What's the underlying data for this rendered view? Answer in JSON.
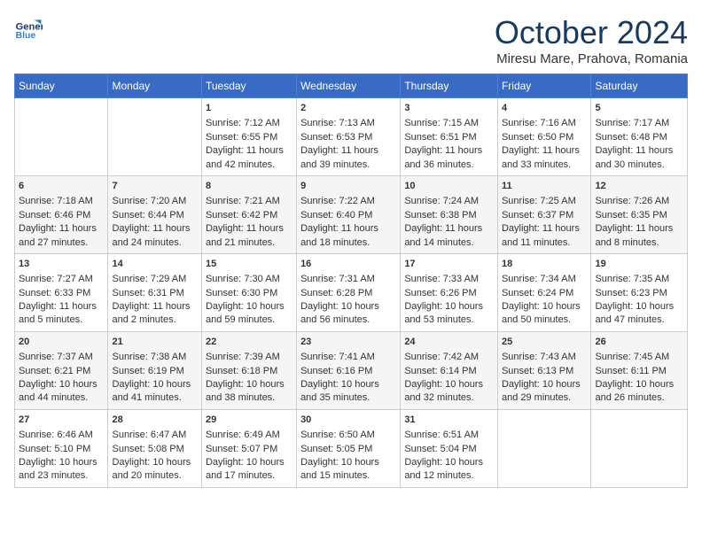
{
  "header": {
    "logo_line1": "General",
    "logo_line2": "Blue",
    "month": "October 2024",
    "location": "Miresu Mare, Prahova, Romania"
  },
  "days_of_week": [
    "Sunday",
    "Monday",
    "Tuesday",
    "Wednesday",
    "Thursday",
    "Friday",
    "Saturday"
  ],
  "weeks": [
    [
      {
        "day": "",
        "info": ""
      },
      {
        "day": "",
        "info": ""
      },
      {
        "day": "1",
        "sunrise": "Sunrise: 7:12 AM",
        "sunset": "Sunset: 6:55 PM",
        "daylight": "Daylight: 11 hours and 42 minutes."
      },
      {
        "day": "2",
        "sunrise": "Sunrise: 7:13 AM",
        "sunset": "Sunset: 6:53 PM",
        "daylight": "Daylight: 11 hours and 39 minutes."
      },
      {
        "day": "3",
        "sunrise": "Sunrise: 7:15 AM",
        "sunset": "Sunset: 6:51 PM",
        "daylight": "Daylight: 11 hours and 36 minutes."
      },
      {
        "day": "4",
        "sunrise": "Sunrise: 7:16 AM",
        "sunset": "Sunset: 6:50 PM",
        "daylight": "Daylight: 11 hours and 33 minutes."
      },
      {
        "day": "5",
        "sunrise": "Sunrise: 7:17 AM",
        "sunset": "Sunset: 6:48 PM",
        "daylight": "Daylight: 11 hours and 30 minutes."
      }
    ],
    [
      {
        "day": "6",
        "sunrise": "Sunrise: 7:18 AM",
        "sunset": "Sunset: 6:46 PM",
        "daylight": "Daylight: 11 hours and 27 minutes."
      },
      {
        "day": "7",
        "sunrise": "Sunrise: 7:20 AM",
        "sunset": "Sunset: 6:44 PM",
        "daylight": "Daylight: 11 hours and 24 minutes."
      },
      {
        "day": "8",
        "sunrise": "Sunrise: 7:21 AM",
        "sunset": "Sunset: 6:42 PM",
        "daylight": "Daylight: 11 hours and 21 minutes."
      },
      {
        "day": "9",
        "sunrise": "Sunrise: 7:22 AM",
        "sunset": "Sunset: 6:40 PM",
        "daylight": "Daylight: 11 hours and 18 minutes."
      },
      {
        "day": "10",
        "sunrise": "Sunrise: 7:24 AM",
        "sunset": "Sunset: 6:38 PM",
        "daylight": "Daylight: 11 hours and 14 minutes."
      },
      {
        "day": "11",
        "sunrise": "Sunrise: 7:25 AM",
        "sunset": "Sunset: 6:37 PM",
        "daylight": "Daylight: 11 hours and 11 minutes."
      },
      {
        "day": "12",
        "sunrise": "Sunrise: 7:26 AM",
        "sunset": "Sunset: 6:35 PM",
        "daylight": "Daylight: 11 hours and 8 minutes."
      }
    ],
    [
      {
        "day": "13",
        "sunrise": "Sunrise: 7:27 AM",
        "sunset": "Sunset: 6:33 PM",
        "daylight": "Daylight: 11 hours and 5 minutes."
      },
      {
        "day": "14",
        "sunrise": "Sunrise: 7:29 AM",
        "sunset": "Sunset: 6:31 PM",
        "daylight": "Daylight: 11 hours and 2 minutes."
      },
      {
        "day": "15",
        "sunrise": "Sunrise: 7:30 AM",
        "sunset": "Sunset: 6:30 PM",
        "daylight": "Daylight: 10 hours and 59 minutes."
      },
      {
        "day": "16",
        "sunrise": "Sunrise: 7:31 AM",
        "sunset": "Sunset: 6:28 PM",
        "daylight": "Daylight: 10 hours and 56 minutes."
      },
      {
        "day": "17",
        "sunrise": "Sunrise: 7:33 AM",
        "sunset": "Sunset: 6:26 PM",
        "daylight": "Daylight: 10 hours and 53 minutes."
      },
      {
        "day": "18",
        "sunrise": "Sunrise: 7:34 AM",
        "sunset": "Sunset: 6:24 PM",
        "daylight": "Daylight: 10 hours and 50 minutes."
      },
      {
        "day": "19",
        "sunrise": "Sunrise: 7:35 AM",
        "sunset": "Sunset: 6:23 PM",
        "daylight": "Daylight: 10 hours and 47 minutes."
      }
    ],
    [
      {
        "day": "20",
        "sunrise": "Sunrise: 7:37 AM",
        "sunset": "Sunset: 6:21 PM",
        "daylight": "Daylight: 10 hours and 44 minutes."
      },
      {
        "day": "21",
        "sunrise": "Sunrise: 7:38 AM",
        "sunset": "Sunset: 6:19 PM",
        "daylight": "Daylight: 10 hours and 41 minutes."
      },
      {
        "day": "22",
        "sunrise": "Sunrise: 7:39 AM",
        "sunset": "Sunset: 6:18 PM",
        "daylight": "Daylight: 10 hours and 38 minutes."
      },
      {
        "day": "23",
        "sunrise": "Sunrise: 7:41 AM",
        "sunset": "Sunset: 6:16 PM",
        "daylight": "Daylight: 10 hours and 35 minutes."
      },
      {
        "day": "24",
        "sunrise": "Sunrise: 7:42 AM",
        "sunset": "Sunset: 6:14 PM",
        "daylight": "Daylight: 10 hours and 32 minutes."
      },
      {
        "day": "25",
        "sunrise": "Sunrise: 7:43 AM",
        "sunset": "Sunset: 6:13 PM",
        "daylight": "Daylight: 10 hours and 29 minutes."
      },
      {
        "day": "26",
        "sunrise": "Sunrise: 7:45 AM",
        "sunset": "Sunset: 6:11 PM",
        "daylight": "Daylight: 10 hours and 26 minutes."
      }
    ],
    [
      {
        "day": "27",
        "sunrise": "Sunrise: 6:46 AM",
        "sunset": "Sunset: 5:10 PM",
        "daylight": "Daylight: 10 hours and 23 minutes."
      },
      {
        "day": "28",
        "sunrise": "Sunrise: 6:47 AM",
        "sunset": "Sunset: 5:08 PM",
        "daylight": "Daylight: 10 hours and 20 minutes."
      },
      {
        "day": "29",
        "sunrise": "Sunrise: 6:49 AM",
        "sunset": "Sunset: 5:07 PM",
        "daylight": "Daylight: 10 hours and 17 minutes."
      },
      {
        "day": "30",
        "sunrise": "Sunrise: 6:50 AM",
        "sunset": "Sunset: 5:05 PM",
        "daylight": "Daylight: 10 hours and 15 minutes."
      },
      {
        "day": "31",
        "sunrise": "Sunrise: 6:51 AM",
        "sunset": "Sunset: 5:04 PM",
        "daylight": "Daylight: 10 hours and 12 minutes."
      },
      {
        "day": "",
        "info": ""
      },
      {
        "day": "",
        "info": ""
      }
    ]
  ]
}
